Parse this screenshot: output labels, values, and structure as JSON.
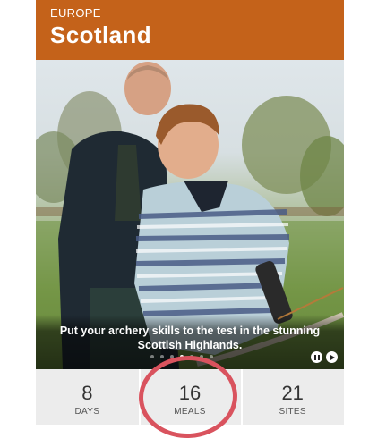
{
  "header": {
    "region": "EUROPE",
    "title": "Scotland",
    "color": "#c4621a"
  },
  "hero": {
    "caption": "Put your archery skills to the test in the stunning Scottish Highlands.",
    "slide_count": 7,
    "active_slide": 4
  },
  "stats": [
    {
      "value": "8",
      "label": "DAYS"
    },
    {
      "value": "16",
      "label": "MEALS"
    },
    {
      "value": "21",
      "label": "SITES"
    }
  ],
  "annotation_color": "#d9535e"
}
